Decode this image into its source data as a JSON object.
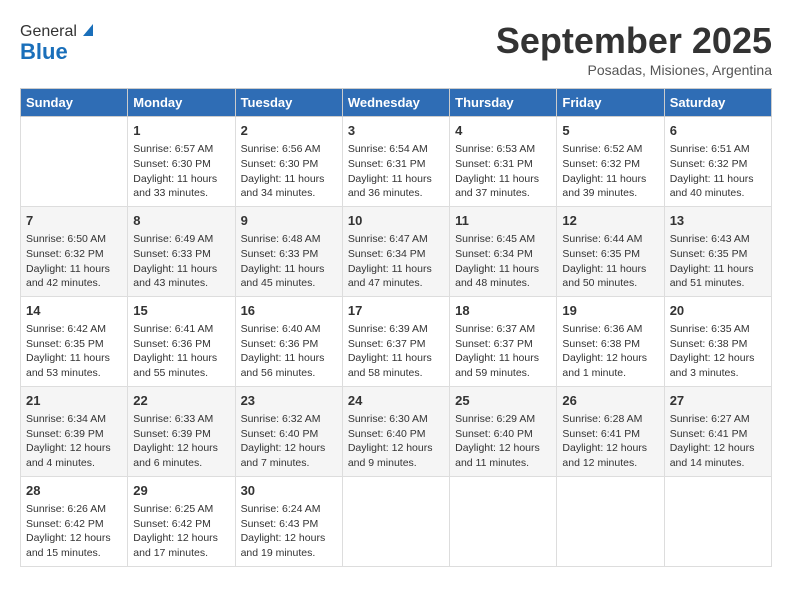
{
  "header": {
    "logo_general": "General",
    "logo_blue": "Blue",
    "month": "September 2025",
    "location": "Posadas, Misiones, Argentina"
  },
  "columns": [
    "Sunday",
    "Monday",
    "Tuesday",
    "Wednesday",
    "Thursday",
    "Friday",
    "Saturday"
  ],
  "weeks": [
    [
      {
        "day": "",
        "info": ""
      },
      {
        "day": "1",
        "info": "Sunrise: 6:57 AM\nSunset: 6:30 PM\nDaylight: 11 hours\nand 33 minutes."
      },
      {
        "day": "2",
        "info": "Sunrise: 6:56 AM\nSunset: 6:30 PM\nDaylight: 11 hours\nand 34 minutes."
      },
      {
        "day": "3",
        "info": "Sunrise: 6:54 AM\nSunset: 6:31 PM\nDaylight: 11 hours\nand 36 minutes."
      },
      {
        "day": "4",
        "info": "Sunrise: 6:53 AM\nSunset: 6:31 PM\nDaylight: 11 hours\nand 37 minutes."
      },
      {
        "day": "5",
        "info": "Sunrise: 6:52 AM\nSunset: 6:32 PM\nDaylight: 11 hours\nand 39 minutes."
      },
      {
        "day": "6",
        "info": "Sunrise: 6:51 AM\nSunset: 6:32 PM\nDaylight: 11 hours\nand 40 minutes."
      }
    ],
    [
      {
        "day": "7",
        "info": "Sunrise: 6:50 AM\nSunset: 6:32 PM\nDaylight: 11 hours\nand 42 minutes."
      },
      {
        "day": "8",
        "info": "Sunrise: 6:49 AM\nSunset: 6:33 PM\nDaylight: 11 hours\nand 43 minutes."
      },
      {
        "day": "9",
        "info": "Sunrise: 6:48 AM\nSunset: 6:33 PM\nDaylight: 11 hours\nand 45 minutes."
      },
      {
        "day": "10",
        "info": "Sunrise: 6:47 AM\nSunset: 6:34 PM\nDaylight: 11 hours\nand 47 minutes."
      },
      {
        "day": "11",
        "info": "Sunrise: 6:45 AM\nSunset: 6:34 PM\nDaylight: 11 hours\nand 48 minutes."
      },
      {
        "day": "12",
        "info": "Sunrise: 6:44 AM\nSunset: 6:35 PM\nDaylight: 11 hours\nand 50 minutes."
      },
      {
        "day": "13",
        "info": "Sunrise: 6:43 AM\nSunset: 6:35 PM\nDaylight: 11 hours\nand 51 minutes."
      }
    ],
    [
      {
        "day": "14",
        "info": "Sunrise: 6:42 AM\nSunset: 6:35 PM\nDaylight: 11 hours\nand 53 minutes."
      },
      {
        "day": "15",
        "info": "Sunrise: 6:41 AM\nSunset: 6:36 PM\nDaylight: 11 hours\nand 55 minutes."
      },
      {
        "day": "16",
        "info": "Sunrise: 6:40 AM\nSunset: 6:36 PM\nDaylight: 11 hours\nand 56 minutes."
      },
      {
        "day": "17",
        "info": "Sunrise: 6:39 AM\nSunset: 6:37 PM\nDaylight: 11 hours\nand 58 minutes."
      },
      {
        "day": "18",
        "info": "Sunrise: 6:37 AM\nSunset: 6:37 PM\nDaylight: 11 hours\nand 59 minutes."
      },
      {
        "day": "19",
        "info": "Sunrise: 6:36 AM\nSunset: 6:38 PM\nDaylight: 12 hours\nand 1 minute."
      },
      {
        "day": "20",
        "info": "Sunrise: 6:35 AM\nSunset: 6:38 PM\nDaylight: 12 hours\nand 3 minutes."
      }
    ],
    [
      {
        "day": "21",
        "info": "Sunrise: 6:34 AM\nSunset: 6:39 PM\nDaylight: 12 hours\nand 4 minutes."
      },
      {
        "day": "22",
        "info": "Sunrise: 6:33 AM\nSunset: 6:39 PM\nDaylight: 12 hours\nand 6 minutes."
      },
      {
        "day": "23",
        "info": "Sunrise: 6:32 AM\nSunset: 6:40 PM\nDaylight: 12 hours\nand 7 minutes."
      },
      {
        "day": "24",
        "info": "Sunrise: 6:30 AM\nSunset: 6:40 PM\nDaylight: 12 hours\nand 9 minutes."
      },
      {
        "day": "25",
        "info": "Sunrise: 6:29 AM\nSunset: 6:40 PM\nDaylight: 12 hours\nand 11 minutes."
      },
      {
        "day": "26",
        "info": "Sunrise: 6:28 AM\nSunset: 6:41 PM\nDaylight: 12 hours\nand 12 minutes."
      },
      {
        "day": "27",
        "info": "Sunrise: 6:27 AM\nSunset: 6:41 PM\nDaylight: 12 hours\nand 14 minutes."
      }
    ],
    [
      {
        "day": "28",
        "info": "Sunrise: 6:26 AM\nSunset: 6:42 PM\nDaylight: 12 hours\nand 15 minutes."
      },
      {
        "day": "29",
        "info": "Sunrise: 6:25 AM\nSunset: 6:42 PM\nDaylight: 12 hours\nand 17 minutes."
      },
      {
        "day": "30",
        "info": "Sunrise: 6:24 AM\nSunset: 6:43 PM\nDaylight: 12 hours\nand 19 minutes."
      },
      {
        "day": "",
        "info": ""
      },
      {
        "day": "",
        "info": ""
      },
      {
        "day": "",
        "info": ""
      },
      {
        "day": "",
        "info": ""
      }
    ]
  ]
}
